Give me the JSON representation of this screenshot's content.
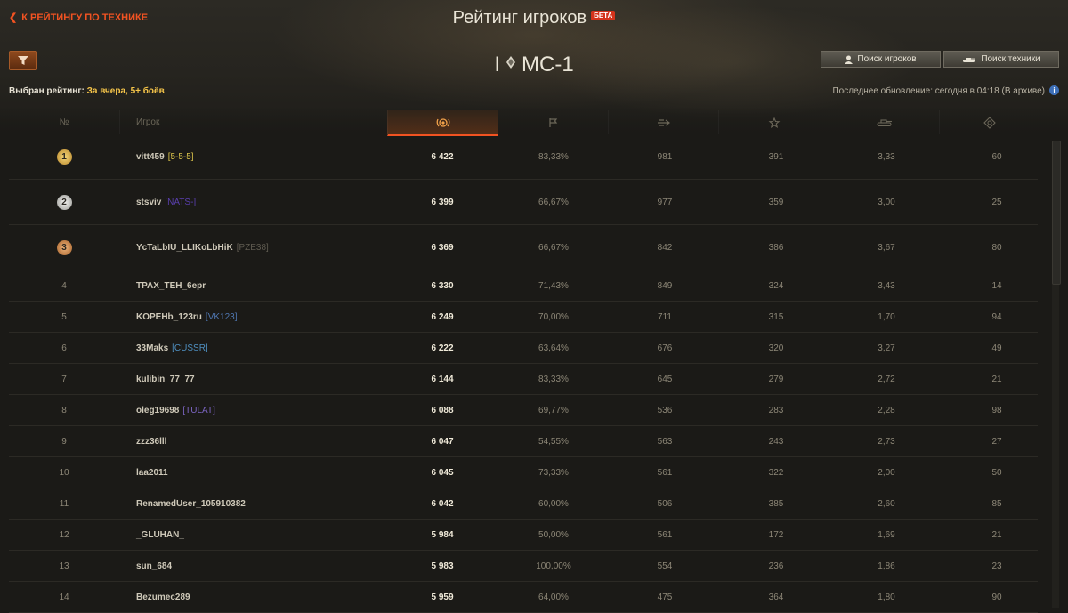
{
  "header": {
    "back_label": "К РЕЙТИНГУ ПО ТЕХНИКЕ",
    "title": "Рейтинг игроков",
    "beta": "БЕТА",
    "vehicle_tier": "I",
    "vehicle_name": "МС-1",
    "search_players": "Поиск игроков",
    "search_vehicles": "Поиск техники",
    "rating_label": "Выбран рейтинг:",
    "rating_value": "За вчера, 5+ боёв",
    "last_update": "Последнее обновление: сегодня в 04:18 (В архиве)",
    "info": "i"
  },
  "columns": {
    "rank": "№",
    "player": "Игрок",
    "rating_icon": "rating-laurel-icon",
    "wins_icon": "flag-icon",
    "damage_icon": "damage-icon",
    "xp_icon": "star-icon",
    "frags_icon": "tank-frags-icon",
    "spot_icon": "spotting-icon"
  },
  "colors": {
    "accent": "#f25322",
    "gold": "#f7c64a",
    "clan_5_5_5": "#d9c24a",
    "clan_nats": "#5a3fae",
    "clan_pze38": "#5f5b50",
    "clan_vk123": "#4f76b0",
    "clan_cussr": "#4f8fc0",
    "clan_tulat": "#7c65c4"
  },
  "rows": [
    {
      "rank": "1",
      "name": "vitt459",
      "clan": "[5-5-5]",
      "clan_color": "#d9c24a",
      "rating": "6 422",
      "wins": "83,33%",
      "damage": "981",
      "xp": "391",
      "frags": "3,33",
      "spot": "60"
    },
    {
      "rank": "2",
      "name": "stsviv",
      "clan": "[NATS-]",
      "clan_color": "#5a3fae",
      "rating": "6 399",
      "wins": "66,67%",
      "damage": "977",
      "xp": "359",
      "frags": "3,00",
      "spot": "25"
    },
    {
      "rank": "3",
      "name": "YcTaLbIU_LLIKoLbHiK",
      "clan": "[PZE38]",
      "clan_color": "#5f5b50",
      "rating": "6 369",
      "wins": "66,67%",
      "damage": "842",
      "xp": "386",
      "frags": "3,67",
      "spot": "80"
    },
    {
      "rank": "4",
      "name": "TPAX_TEH_6epr",
      "clan": "",
      "clan_color": "#8d8777",
      "rating": "6 330",
      "wins": "71,43%",
      "damage": "849",
      "xp": "324",
      "frags": "3,43",
      "spot": "14"
    },
    {
      "rank": "5",
      "name": "KOPEHb_123ru",
      "clan": "[VK123]",
      "clan_color": "#4f76b0",
      "rating": "6 249",
      "wins": "70,00%",
      "damage": "711",
      "xp": "315",
      "frags": "1,70",
      "spot": "94"
    },
    {
      "rank": "6",
      "name": "33Maks",
      "clan": "[CUSSR]",
      "clan_color": "#4f8fc0",
      "rating": "6 222",
      "wins": "63,64%",
      "damage": "676",
      "xp": "320",
      "frags": "3,27",
      "spot": "49"
    },
    {
      "rank": "7",
      "name": "kulibin_77_77",
      "clan": "",
      "clan_color": "#8d8777",
      "rating": "6 144",
      "wins": "83,33%",
      "damage": "645",
      "xp": "279",
      "frags": "2,72",
      "spot": "21"
    },
    {
      "rank": "8",
      "name": "oleg19698",
      "clan": "[TULAT]",
      "clan_color": "#7c65c4",
      "rating": "6 088",
      "wins": "69,77%",
      "damage": "536",
      "xp": "283",
      "frags": "2,28",
      "spot": "98"
    },
    {
      "rank": "9",
      "name": "zzz36lll",
      "clan": "",
      "clan_color": "#8d8777",
      "rating": "6 047",
      "wins": "54,55%",
      "damage": "563",
      "xp": "243",
      "frags": "2,73",
      "spot": "27"
    },
    {
      "rank": "10",
      "name": "laa2011",
      "clan": "",
      "clan_color": "#8d8777",
      "rating": "6 045",
      "wins": "73,33%",
      "damage": "561",
      "xp": "322",
      "frags": "2,00",
      "spot": "50"
    },
    {
      "rank": "11",
      "name": "RenamedUser_105910382",
      "clan": "",
      "clan_color": "#8d8777",
      "rating": "6 042",
      "wins": "60,00%",
      "damage": "506",
      "xp": "385",
      "frags": "2,60",
      "spot": "85"
    },
    {
      "rank": "12",
      "name": "_GLUHAN_",
      "clan": "",
      "clan_color": "#8d8777",
      "rating": "5 984",
      "wins": "50,00%",
      "damage": "561",
      "xp": "172",
      "frags": "1,69",
      "spot": "21"
    },
    {
      "rank": "13",
      "name": "sun_684",
      "clan": "",
      "clan_color": "#8d8777",
      "rating": "5 983",
      "wins": "100,00%",
      "damage": "554",
      "xp": "236",
      "frags": "1,86",
      "spot": "23"
    },
    {
      "rank": "14",
      "name": "Bezumec289",
      "clan": "",
      "clan_color": "#8d8777",
      "rating": "5 959",
      "wins": "64,00%",
      "damage": "475",
      "xp": "364",
      "frags": "1,80",
      "spot": "90"
    }
  ]
}
